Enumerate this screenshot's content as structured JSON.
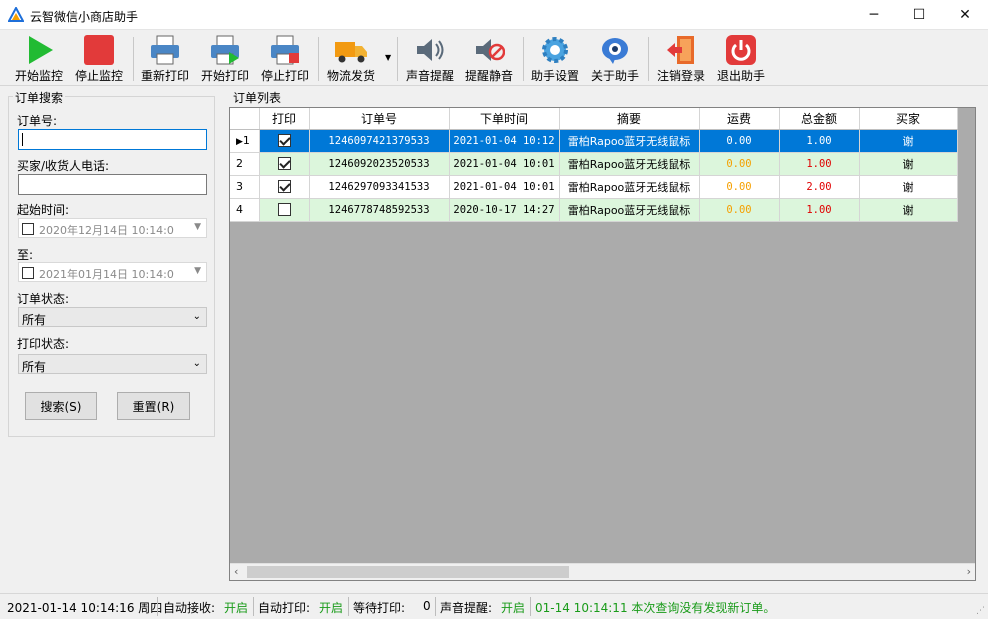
{
  "window": {
    "title": "云智微信小商店助手",
    "min": "─",
    "max": "☐",
    "close": "✕"
  },
  "toolbar": {
    "start_monitor": "开始监控",
    "stop_monitor": "停止监控",
    "reprint": "重新打印",
    "start_print": "开始打印",
    "stop_print": "停止打印",
    "ship": "物流发货",
    "sound_alert": "声音提醒",
    "mute_alert": "提醒静音",
    "settings": "助手设置",
    "about": "关于助手",
    "logout": "注销登录",
    "exit": "退出助手"
  },
  "search": {
    "group_title": "订单搜索",
    "order_no_label": "订单号:",
    "order_no_value": "",
    "phone_label": "买家/收货人电话:",
    "phone_value": "",
    "start_label": "起始时间:",
    "start_value": "2020年12月14日  10:14:0",
    "end_label": "至:",
    "end_value": "2021年01月14日  10:14:0",
    "status_label": "订单状态:",
    "status_value": "所有",
    "print_status_label": "打印状态:",
    "print_status_value": "所有",
    "search_btn": "搜索(S)",
    "reset_btn": "重置(R)"
  },
  "grid": {
    "title": "订单列表",
    "columns": [
      "打印",
      "订单号",
      "下单时间",
      "摘要",
      "运费",
      "总金额",
      "买家"
    ],
    "rows": [
      {
        "idx": "1",
        "printed": true,
        "order_no": "1246097421379533",
        "time": "2021-01-04 10:12",
        "summary": "雷柏Rapoo蓝牙无线鼠标",
        "freight": "0.00",
        "total": "1.00",
        "buyer": "谢"
      },
      {
        "idx": "2",
        "printed": true,
        "order_no": "1246092023520533",
        "time": "2021-01-04 10:01",
        "summary": "雷柏Rapoo蓝牙无线鼠标",
        "freight": "0.00",
        "total": "1.00",
        "buyer": "谢"
      },
      {
        "idx": "3",
        "printed": true,
        "order_no": "1246297093341533",
        "time": "2021-01-04 10:01",
        "summary": "雷柏Rapoo蓝牙无线鼠标",
        "freight": "0.00",
        "total": "2.00",
        "buyer": "谢"
      },
      {
        "idx": "4",
        "printed": false,
        "order_no": "1246778748592533",
        "time": "2020-10-17 14:27",
        "summary": "雷柏Rapoo蓝牙无线鼠标",
        "freight": "0.00",
        "total": "1.00",
        "buyer": "谢"
      }
    ]
  },
  "status": {
    "datetime": "2021-01-14 10:14:16 周四",
    "auto_receive_label": "自动接收:",
    "auto_receive_value": "开启",
    "auto_print_label": "自动打印:",
    "auto_print_value": "开启",
    "waiting_label": "等待打印:",
    "waiting_value": "0",
    "sound_label": "声音提醒:",
    "sound_value": "开启",
    "message": "01-14 10:14:11 本次查询没有发现新订单。"
  }
}
